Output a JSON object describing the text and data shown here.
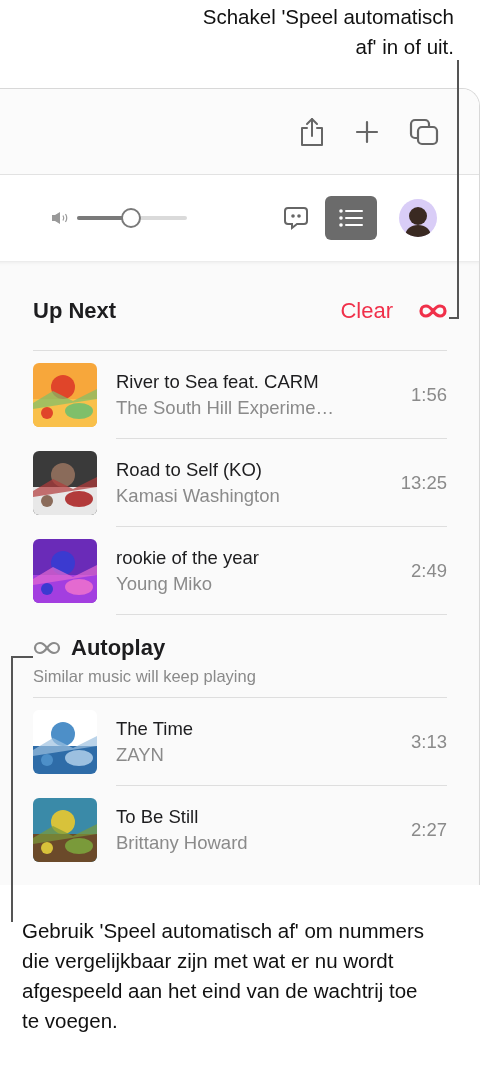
{
  "callout_top": "Schakel 'Speel automatisch af' in of uit.",
  "toolbar": {
    "volume": {
      "level": 0.49
    },
    "queue_button": {
      "selected": true
    }
  },
  "up_next": {
    "title": "Up Next",
    "clear": "Clear",
    "autoplay_toggle": {
      "on": true
    },
    "tracks": [
      {
        "title": "River to Sea feat. CARM",
        "artist": "The South Hill Experime…",
        "duration": "1:56"
      },
      {
        "title": "Road to Self (KO)",
        "artist": "Kamasi Washington",
        "duration": "13:25"
      },
      {
        "title": "rookie of the year",
        "artist": "Young Miko",
        "duration": "2:49"
      }
    ]
  },
  "autoplay": {
    "title": "Autoplay",
    "subtitle": "Similar music will keep playing",
    "tracks": [
      {
        "title": "The Time",
        "artist": "ZAYN",
        "duration": "3:13"
      },
      {
        "title": "To Be Still",
        "artist": "Brittany Howard",
        "duration": "2:27"
      }
    ]
  },
  "callout_bottom": "Gebruik 'Speel automatisch af' om nummers die vergelijkbaar zijn met wat er nu wordt afgespeeld aan het eind van de wachtrij toe te voegen."
}
